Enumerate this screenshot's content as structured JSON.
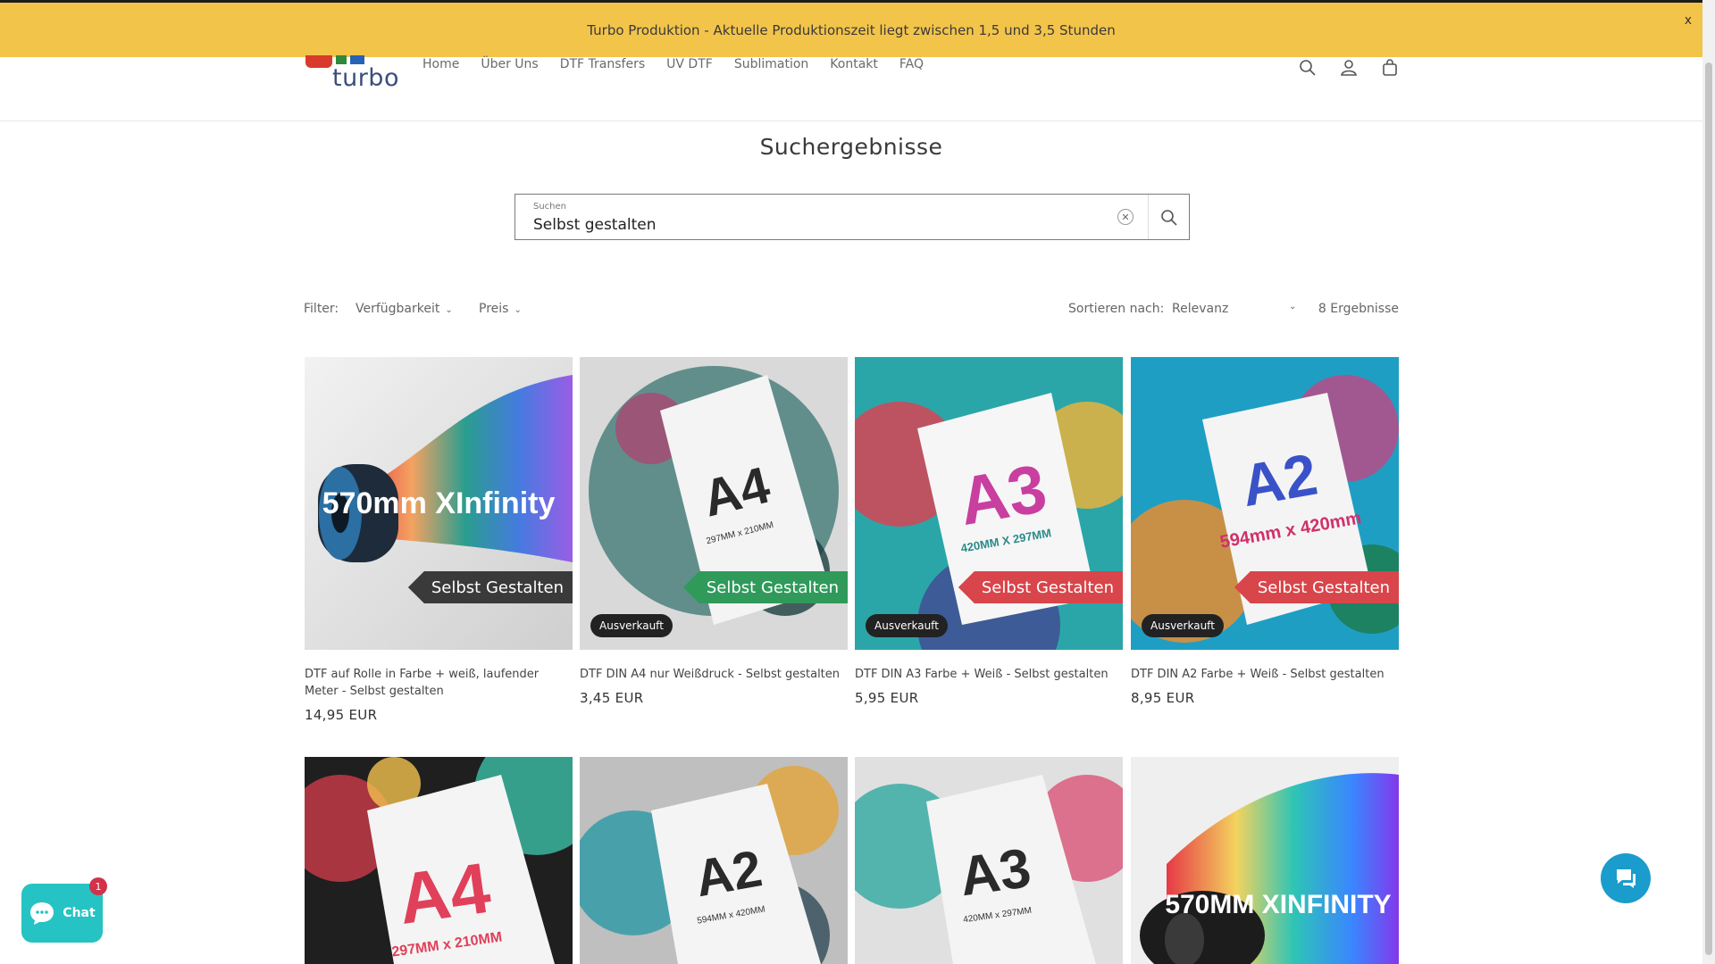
{
  "announcement": {
    "text": "Turbo Produktion - Aktuelle Produktionszeit liegt zwischen 1,5 und 3,5 Stunden",
    "close": "x"
  },
  "header": {
    "logo_text": "turbo",
    "nav": [
      "Home",
      "Über Uns",
      "DTF Transfers",
      "UV DTF",
      "Sublimation",
      "Kontakt",
      "FAQ"
    ],
    "icons": [
      "search-icon",
      "account-icon",
      "cart-icon"
    ]
  },
  "page_title": "Suchergebnisse",
  "search": {
    "label": "Suchen",
    "value": "Selbst gestalten"
  },
  "filters": {
    "label": "Filter:",
    "availability": "Verfügbarkeit",
    "price": "Preis",
    "sort_label": "Sortieren nach:",
    "sort_value": "Relevanz",
    "result_count": "8 Ergebnisse"
  },
  "products": [
    {
      "title": "DTF auf Rolle in Farbe + weiß, laufender Meter - Selbst gestalten",
      "price": "14,95 EUR",
      "badge": "Selbst Gestalten",
      "sold_out": "",
      "art": "570mm XInfinity",
      "badge_color": "#3a3a3a"
    },
    {
      "title": "DTF DIN A4 nur Weißdruck - Selbst gestalten",
      "price": "3,45 EUR",
      "badge": "Selbst Gestalten",
      "sold_out": "Ausverkauft",
      "art": "A4",
      "badge_color": "#2f9a5a"
    },
    {
      "title": "DTF DIN A3 Farbe + Weiß - Selbst gestalten",
      "price": "5,95 EUR",
      "badge": "Selbst Gestalten",
      "sold_out": "Ausverkauft",
      "art": "A3",
      "badge_color": "#d8454a"
    },
    {
      "title": "DTF DIN A2 Farbe + Weiß - Selbst gestalten",
      "price": "8,95 EUR",
      "badge": "Selbst Gestalten",
      "sold_out": "Ausverkauft",
      "art": "A2",
      "badge_color": "#d8454a"
    },
    {
      "title": "",
      "price": "",
      "art": "A4"
    },
    {
      "title": "",
      "price": "",
      "art": "A2"
    },
    {
      "title": "",
      "price": "",
      "art": "A3"
    },
    {
      "title": "",
      "price": "",
      "art": "570MM XINFINITY"
    }
  ],
  "art_sub": [
    "297MM x 210MM",
    "420MM X 297MM",
    "594mm x 420mm",
    "297MM x 210MM",
    "594MM x 420MM",
    "420MM x 297MM"
  ],
  "chat": {
    "label": "Chat",
    "badge": "1"
  },
  "colors": {
    "announcement": "#f3c44a",
    "chat": "#25c3c3",
    "messenger": "#1a9ccd"
  }
}
